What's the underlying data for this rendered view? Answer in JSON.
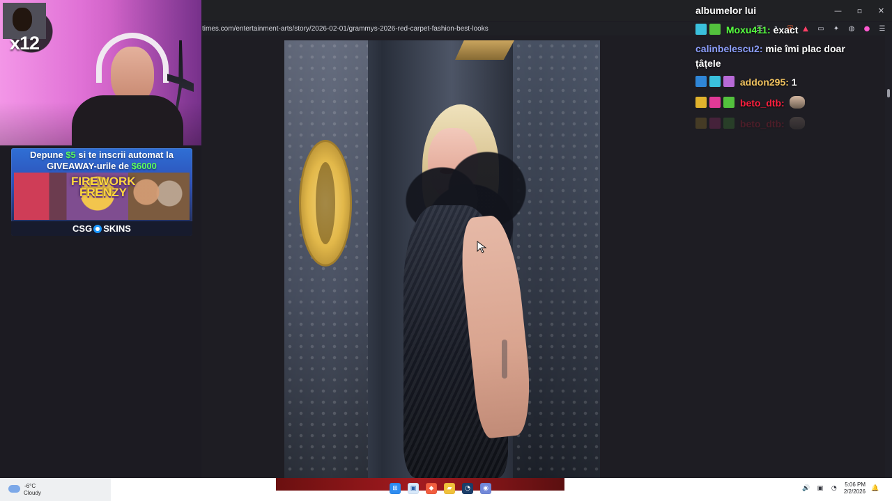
{
  "browser": {
    "address_url": "times.com/entertainment-arts/story/2026-02-01/grammys-2026-red-carpet-fashion-best-looks"
  },
  "stream_overlay": {
    "multiplier": "x12",
    "ad": {
      "line_1_prefix": "Depune ",
      "line_1_amount": "$5",
      "line_1_suffix": " si te inscrii automat la",
      "line_2_prefix": "GIVEAWAY-urile de ",
      "line_2_amount": "$6000",
      "title": "FIREWORK FRENZY",
      "brand_left": "CSG",
      "brand_right": "SKINS"
    }
  },
  "chat": {
    "lines": [
      {
        "text": "albumelor lui"
      },
      {
        "user": "Moxu411:",
        "message": " exact",
        "user_color": "#56ff3f"
      },
      {
        "user": "calinbelescu2:",
        "message": " mie îmi plac doar",
        "user_color": "#8ea0ff"
      },
      {
        "text": "țâțele"
      },
      {
        "user": "addon295:",
        "message": " 1",
        "user_color": "#f0c25f"
      },
      {
        "user": "beto_dtb:",
        "message": "",
        "user_color": "#ff1f3e"
      },
      {
        "user": "beto_dtb:",
        "message": "",
        "user_color": "#ff1f3e"
      }
    ]
  },
  "taskbar": {
    "weather": {
      "temp": "-6°C",
      "condition": "Cloudy"
    },
    "clock": {
      "time": "5:06 PM",
      "date": "2/2/2026"
    }
  }
}
